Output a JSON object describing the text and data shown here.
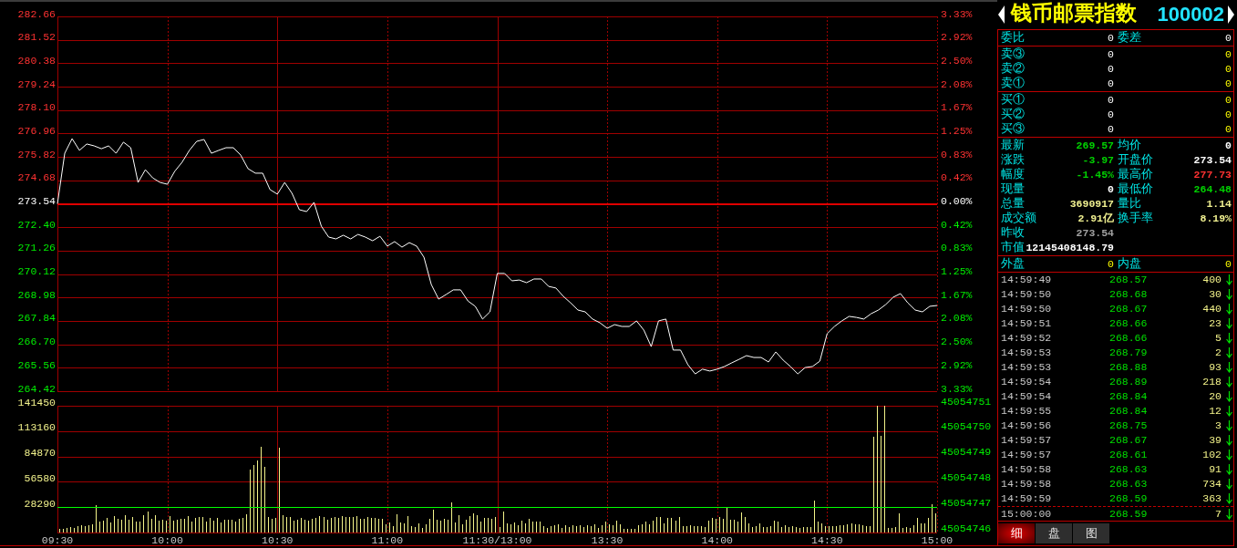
{
  "price_chart": {
    "right_axis_labels": [
      "3.33%",
      "2.92%",
      "2.50%",
      "2.08%",
      "1.67%",
      "1.25%",
      "0.83%",
      "0.42%",
      "0.00%",
      "0.42%",
      "0.83%",
      "1.25%",
      "1.67%",
      "2.08%",
      "2.50%",
      "2.92%",
      "3.33%"
    ],
    "chart_data": {
      "type": "line",
      "categories": [
        null,
        null,
        null,
        null,
        null,
        null,
        null,
        null,
        null,
        null,
        null,
        null,
        null,
        null,
        null,
        null,
        null,
        null,
        null,
        null,
        null,
        null,
        null,
        null,
        null,
        null,
        null,
        null,
        null,
        null,
        null,
        null,
        null,
        null,
        null,
        null,
        null,
        null,
        null,
        null,
        null,
        null,
        null,
        null,
        null,
        null,
        null,
        null,
        null,
        null,
        null,
        null,
        null,
        null,
        null,
        null,
        null,
        null,
        null,
        null,
        null,
        null,
        null,
        null,
        null,
        null,
        null,
        null,
        null,
        null,
        null,
        null,
        null,
        null,
        null,
        null,
        null,
        null,
        null,
        null,
        null,
        null,
        null,
        null,
        null,
        null,
        null,
        null,
        null,
        null,
        null,
        null,
        null,
        null,
        null,
        null,
        null,
        null,
        null,
        null,
        null,
        null,
        null,
        null,
        null,
        null,
        null,
        null,
        null,
        null,
        null,
        null,
        null,
        null,
        null,
        null,
        null,
        null,
        null,
        null,
        null
      ],
      "series": [
        {
          "color": "#ffffff",
          "values": [
            273.54,
            276.0,
            276.71,
            276.14,
            276.45,
            276.36,
            276.22,
            276.36,
            276.0,
            276.54,
            276.27,
            274.58,
            275.2,
            274.8,
            274.58,
            274.49,
            275.12,
            275.56,
            276.14,
            276.58,
            276.67,
            276.0,
            276.14,
            276.27,
            276.27,
            275.91,
            275.25,
            275.03,
            275.03,
            274.23,
            274.01,
            274.58,
            274.05,
            273.25,
            273.16,
            273.61,
            272.45,
            271.92,
            271.83,
            272.01,
            271.83,
            272.05,
            271.92,
            271.74,
            271.96,
            271.48,
            271.7,
            271.43,
            271.65,
            271.48,
            270.94,
            269.61,
            268.9,
            269.12,
            269.35,
            269.35,
            268.81,
            268.55,
            267.93,
            268.28,
            270.15,
            270.15,
            269.79,
            269.83,
            269.7,
            269.88,
            269.88,
            269.52,
            269.44,
            269.04,
            268.72,
            268.37,
            268.28,
            267.93,
            267.75,
            267.48,
            267.66,
            267.57,
            267.57,
            267.84,
            267.39,
            266.59,
            267.84,
            267.93,
            266.42,
            266.42,
            265.71,
            265.26,
            265.49,
            265.4,
            265.49,
            265.62,
            265.8,
            265.97,
            266.15,
            266.06,
            266.06,
            265.84,
            266.33,
            265.93,
            265.62,
            265.26,
            265.57,
            265.62,
            265.88,
            267.22,
            267.57,
            267.84,
            268.06,
            268.01,
            267.93,
            268.19,
            268.37,
            268.64,
            268.99,
            269.17,
            268.72,
            268.37,
            268.28,
            268.55,
            268.59
          ]
        }
      ],
      "ylim": [
        264.42,
        282.66
      ],
      "yticks": [
        {
          "value": 282.66,
          "label": "282.66"
        },
        {
          "value": 281.52,
          "label": "281.52"
        },
        {
          "value": 280.38,
          "label": "280.38"
        },
        {
          "value": 279.24,
          "label": "279.24"
        },
        {
          "value": 278.1,
          "label": "278.10"
        },
        {
          "value": 276.96,
          "label": "276.96"
        },
        {
          "value": 275.82,
          "label": "275.82"
        },
        {
          "value": 274.68,
          "label": "274.68"
        },
        {
          "value": 273.54,
          "label": "273.54"
        },
        {
          "value": 272.4,
          "label": "272.40"
        },
        {
          "value": 271.26,
          "label": "271.26"
        },
        {
          "value": 270.12,
          "label": "270.12"
        },
        {
          "value": 268.98,
          "label": "268.98"
        },
        {
          "value": 267.84,
          "label": "267.84"
        },
        {
          "value": 266.7,
          "label": "266.70"
        },
        {
          "value": 265.56,
          "label": "265.56"
        },
        {
          "value": 264.42,
          "label": "264.42"
        }
      ],
      "grid": true,
      "ref_lines": [
        {
          "axis": "y",
          "value": 273.54,
          "color": "#e00000"
        }
      ]
    }
  },
  "volume_chart": {
    "right_axis_labels": [
      "45054751",
      "45054750",
      "45054749",
      "45054748",
      "45054747",
      "45054746"
    ],
    "chart_data": {
      "type": "bar",
      "categories": [
        "09:30",
        null,
        null,
        null,
        null,
        null,
        null,
        null,
        null,
        null,
        null,
        null,
        null,
        null,
        null,
        null,
        null,
        null,
        null,
        null,
        null,
        null,
        null,
        null,
        null,
        null,
        null,
        null,
        null,
        null,
        "10:00",
        null,
        null,
        null,
        null,
        null,
        null,
        null,
        null,
        null,
        null,
        null,
        null,
        null,
        null,
        null,
        null,
        null,
        null,
        null,
        null,
        null,
        null,
        null,
        null,
        null,
        null,
        null,
        null,
        null,
        "10:30",
        null,
        null,
        null,
        null,
        null,
        null,
        null,
        null,
        null,
        null,
        null,
        null,
        null,
        null,
        null,
        null,
        null,
        null,
        null,
        null,
        null,
        null,
        null,
        null,
        null,
        null,
        null,
        null,
        null,
        "11:00",
        null,
        null,
        null,
        null,
        null,
        null,
        null,
        null,
        null,
        null,
        null,
        null,
        null,
        null,
        null,
        null,
        null,
        null,
        null,
        null,
        null,
        null,
        null,
        null,
        null,
        null,
        null,
        null,
        null,
        "11:30/13:00",
        null,
        null,
        null,
        null,
        null,
        null,
        null,
        null,
        null,
        null,
        null,
        null,
        null,
        null,
        null,
        null,
        null,
        null,
        null,
        null,
        null,
        null,
        null,
        null,
        null,
        null,
        null,
        null,
        null,
        "13:30",
        null,
        null,
        null,
        null,
        null,
        null,
        null,
        null,
        null,
        null,
        null,
        null,
        null,
        null,
        null,
        null,
        null,
        null,
        null,
        null,
        null,
        null,
        null,
        null,
        null,
        null,
        null,
        null,
        null,
        "14:00",
        null,
        null,
        null,
        null,
        null,
        null,
        null,
        null,
        null,
        null,
        null,
        null,
        null,
        null,
        null,
        null,
        null,
        null,
        null,
        null,
        null,
        null,
        null,
        null,
        null,
        null,
        null,
        null,
        null,
        "14:30",
        null,
        null,
        null,
        null,
        null,
        null,
        null,
        null,
        null,
        null,
        null,
        null,
        null,
        null,
        null,
        null,
        null,
        null,
        null,
        null,
        null,
        null,
        null,
        null,
        null,
        null,
        null,
        null,
        null,
        "15:00"
      ],
      "series": [
        {
          "color": "#f4f48a",
          "values": [
            4000,
            4000,
            5000,
            6000,
            5000,
            7000,
            8000,
            7000,
            8000,
            9000,
            31000,
            12000,
            13000,
            16000,
            11000,
            18000,
            15000,
            14000,
            19000,
            14000,
            17000,
            12000,
            12000,
            19000,
            23000,
            15000,
            19000,
            13000,
            14000,
            13000,
            18000,
            13000,
            14000,
            15000,
            15000,
            18000,
            12000,
            16000,
            17000,
            17000,
            12000,
            16000,
            13000,
            16000,
            11000,
            14000,
            14000,
            14000,
            12000,
            15000,
            16000,
            20000,
            70000,
            75000,
            80000,
            96000,
            73000,
            17000,
            15000,
            16000,
            95000,
            19000,
            17000,
            17000,
            13000,
            14000,
            16000,
            14000,
            13000,
            15000,
            16000,
            18000,
            17000,
            14000,
            16000,
            17000,
            16000,
            18000,
            17000,
            17000,
            17000,
            18000,
            15000,
            15000,
            17000,
            16000,
            16000,
            15000,
            15000,
            9000,
            11000,
            7000,
            20000,
            11000,
            10000,
            18000,
            7000,
            6000,
            10000,
            5000,
            9000,
            15000,
            25000,
            14000,
            13000,
            15000,
            14000,
            34000,
            11000,
            19000,
            9000,
            14000,
            18000,
            21000,
            19000,
            12000,
            16000,
            16000,
            15000,
            17000,
            6000,
            23000,
            10000,
            9000,
            11000,
            8000,
            13000,
            10000,
            15000,
            12000,
            12000,
            12000,
            7000,
            5000,
            7000,
            8000,
            9000,
            5000,
            8000,
            6000,
            8000,
            7000,
            8000,
            6000,
            8000,
            7000,
            9000,
            5000,
            8000,
            12000,
            9000,
            8000,
            13000,
            9000,
            4000,
            4000,
            4000,
            4000,
            8000,
            9000,
            12000,
            9000,
            13000,
            17000,
            17000,
            10000,
            16000,
            16000,
            13000,
            17000,
            7000,
            7000,
            8000,
            7000,
            7000,
            7000,
            6000,
            13000,
            16000,
            15000,
            17000,
            15000,
            28000,
            14000,
            14000,
            12000,
            22000,
            17000,
            10000,
            6000,
            7000,
            10000,
            6000,
            6000,
            7000,
            13000,
            12000,
            6000,
            8000,
            6000,
            7000,
            6000,
            5000,
            6000,
            6000,
            6000,
            36000,
            12000,
            10000,
            7000,
            7000,
            7000,
            7000,
            8000,
            8000,
            9000,
            10000,
            9000,
            9000,
            8000,
            7000,
            7000,
            107000,
            141000,
            108000,
            141000,
            5000,
            5000,
            6000,
            21000,
            5000,
            6000,
            5000,
            8000,
            16000,
            10000,
            10000,
            16000,
            32000,
            21000,
            null
          ]
        }
      ],
      "ylim": [
        0,
        141450
      ],
      "yticks": [
        {
          "value": 141450,
          "label": "141450"
        },
        {
          "value": 113160,
          "label": "113160"
        },
        {
          "value": 84870,
          "label": "84870"
        },
        {
          "value": 56580,
          "label": "56580"
        },
        {
          "value": 28290,
          "label": "28290"
        }
      ],
      "grid": true,
      "ref_lines": [
        {
          "axis": "y",
          "value": 28290,
          "color": "#00ff00"
        }
      ]
    }
  },
  "quote_panel": {
    "header": {
      "title": "钱币邮票指数",
      "code": "100002"
    },
    "order_ratio": [
      {
        "label": "委比",
        "value": "0"
      },
      {
        "label": "委差",
        "value": "0"
      }
    ],
    "asks": [
      {
        "label": "卖③",
        "price": "0",
        "volume": "0"
      },
      {
        "label": "卖②",
        "price": "0",
        "volume": "0"
      },
      {
        "label": "卖①",
        "price": "0",
        "volume": "0"
      }
    ],
    "bids": [
      {
        "label": "买①",
        "price": "0",
        "volume": "0"
      },
      {
        "label": "买②",
        "price": "0",
        "volume": "0"
      },
      {
        "label": "买③",
        "price": "0",
        "volume": "0"
      }
    ],
    "quote_rows": [
      {
        "cells": [
          {
            "label": "最新",
            "value": "269.57",
            "color": "#00d200"
          },
          {
            "label": "均价",
            "value": "0",
            "color": "#ffffff"
          }
        ]
      },
      {
        "cells": [
          {
            "label": "涨跌",
            "value": "-3.97",
            "color": "#00d200"
          },
          {
            "label": "开盘价",
            "value": "273.54",
            "color": "#ffffff"
          }
        ]
      },
      {
        "cells": [
          {
            "label": "幅度",
            "value": "-1.45%",
            "color": "#00d200"
          },
          {
            "label": "最高价",
            "value": "277.73",
            "color": "#ff3232"
          }
        ]
      },
      {
        "cells": [
          {
            "label": "现量",
            "value": "0",
            "color": "#ffffff"
          },
          {
            "label": "最低价",
            "value": "264.48",
            "color": "#00d200"
          }
        ]
      },
      {
        "cells": [
          {
            "label": "总量",
            "value": "3690917",
            "color": "#f0f090"
          },
          {
            "label": "量比",
            "value": "1.14",
            "color": "#f0f090"
          }
        ]
      },
      {
        "cells": [
          {
            "label": "成交额",
            "value": "2.91亿",
            "color": "#f0f090"
          },
          {
            "label": "换手率",
            "value": "8.19%",
            "color": "#f0f090"
          }
        ]
      },
      {
        "cells": [
          {
            "label": "昨收",
            "value": "273.54",
            "color": "#a0a0a0"
          }
        ]
      },
      {
        "cells": [
          {
            "label": "市值",
            "value": "12145408148.79",
            "color": "#ffffff"
          }
        ]
      }
    ],
    "outer_inner": [
      {
        "label": "外盘",
        "value": "0"
      },
      {
        "label": "内盘",
        "value": "0"
      }
    ],
    "ticks": [
      {
        "time": "14:59:49",
        "price": "268.57",
        "volume": "400",
        "down": true
      },
      {
        "time": "14:59:50",
        "price": "268.68",
        "volume": "30",
        "down": true
      },
      {
        "time": "14:59:50",
        "price": "268.67",
        "volume": "440",
        "down": true
      },
      {
        "time": "14:59:51",
        "price": "268.66",
        "volume": "23",
        "down": true
      },
      {
        "time": "14:59:52",
        "price": "268.66",
        "volume": "5",
        "down": true
      },
      {
        "time": "14:59:53",
        "price": "268.79",
        "volume": "2",
        "down": true
      },
      {
        "time": "14:59:53",
        "price": "268.88",
        "volume": "93",
        "down": true
      },
      {
        "time": "14:59:54",
        "price": "268.89",
        "volume": "218",
        "down": true
      },
      {
        "time": "14:59:54",
        "price": "268.84",
        "volume": "20",
        "down": true
      },
      {
        "time": "14:59:55",
        "price": "268.84",
        "volume": "12",
        "down": true
      },
      {
        "time": "14:59:56",
        "price": "268.75",
        "volume": "3",
        "down": true
      },
      {
        "time": "14:59:57",
        "price": "268.67",
        "volume": "39",
        "down": true
      },
      {
        "time": "14:59:57",
        "price": "268.61",
        "volume": "102",
        "down": true
      },
      {
        "time": "14:59:58",
        "price": "268.63",
        "volume": "91",
        "down": true
      },
      {
        "time": "14:59:58",
        "price": "268.63",
        "volume": "734",
        "down": true
      },
      {
        "time": "14:59:59",
        "price": "268.59",
        "volume": "363",
        "down": true
      },
      {
        "time": "15:00:00",
        "price": "268.59",
        "volume": "7",
        "down": true
      }
    ],
    "tabs": [
      {
        "label": "细",
        "selected": true
      },
      {
        "label": "盘",
        "selected": false
      },
      {
        "label": "图",
        "selected": false
      }
    ]
  }
}
